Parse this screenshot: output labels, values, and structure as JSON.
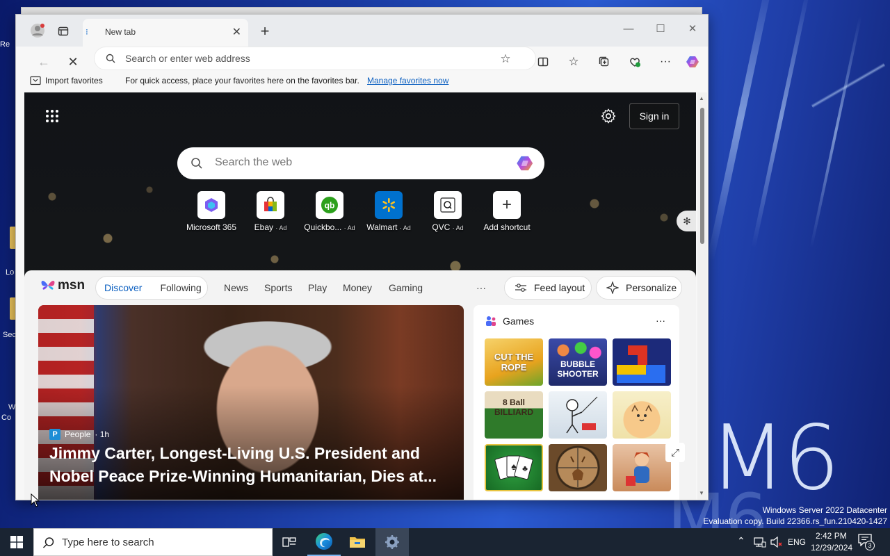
{
  "desktop": {
    "background_text": "M6",
    "left_icons": [
      "Re",
      "Lo",
      "Sec",
      "W",
      "Co"
    ],
    "watermark": {
      "line1": "Windows Server 2022 Datacenter",
      "line2": "Evaluation copy. Build 22366.rs_fun.210420-1427"
    }
  },
  "browser": {
    "tab": {
      "title": "New tab"
    },
    "window_controls": {
      "minimize": "—",
      "maximize": "☐",
      "close": "✕"
    },
    "address_bar": {
      "placeholder": "Search or enter web address",
      "value": ""
    },
    "favorites_bar": {
      "import_label": "Import favorites",
      "message": "For quick access, place your favorites here on the favorites bar.",
      "manage_link": "Manage favorites now"
    }
  },
  "newtab": {
    "sign_in": "Sign in",
    "search": {
      "placeholder": "Search the web"
    },
    "shortcuts": [
      {
        "label": "Microsoft 365",
        "ad": "",
        "icon": "m365-icon",
        "color": "#7b5cf0"
      },
      {
        "label": "Ebay",
        "ad": "· Ad",
        "icon": "ebay-bag-icon",
        "color": "#e53238"
      },
      {
        "label": "Quickbo...",
        "ad": "· Ad",
        "icon": "quickbooks-icon",
        "color": "#2ca01c"
      },
      {
        "label": "Walmart",
        "ad": "· Ad",
        "icon": "walmart-spark-icon",
        "color": "#0071ce"
      },
      {
        "label": "QVC",
        "ad": "· Ad",
        "icon": "qvc-icon",
        "color": "#333333"
      },
      {
        "label": "Add shortcut",
        "ad": "",
        "icon": "plus-icon",
        "color": "#333333"
      }
    ]
  },
  "feed": {
    "brand": "msn",
    "tabs": {
      "discover": "Discover",
      "following": "Following"
    },
    "nav": [
      "News",
      "Sports",
      "Play",
      "Money",
      "Gaming"
    ],
    "more": "···",
    "feed_layout": "Feed layout",
    "personalize": "Personalize",
    "hero": {
      "source": "People",
      "age": "· 1h",
      "source_badge": "P",
      "title": "Jimmy Carter, Longest-Living U.S. President and Nobel Peace Prize-Winning Humanitarian, Dies at..."
    },
    "games": {
      "title": "Games",
      "more": "···",
      "tiles": [
        {
          "label": "CUT THE ROPE",
          "color": "#e8a31e"
        },
        {
          "label": "BUBBLE SHOOTER",
          "color": "#3a4aa8"
        },
        {
          "label": "",
          "color": "#1c2a7a"
        },
        {
          "label": "8 Ball BILLIARD",
          "color": "#2f5a2a"
        },
        {
          "label": "",
          "color": "#dfe7ee"
        },
        {
          "label": "",
          "color": "#f0e6b8"
        },
        {
          "label": "♠ ♣",
          "color": "#1f7a2c"
        },
        {
          "label": "",
          "color": "#6b4a2a"
        },
        {
          "label": "",
          "color": "#c98a5a"
        }
      ]
    }
  },
  "taskbar": {
    "search_placeholder": "Type here to search",
    "language": "ENG",
    "time": "2:42 PM",
    "date": "12/29/2024",
    "notifications": "3"
  }
}
